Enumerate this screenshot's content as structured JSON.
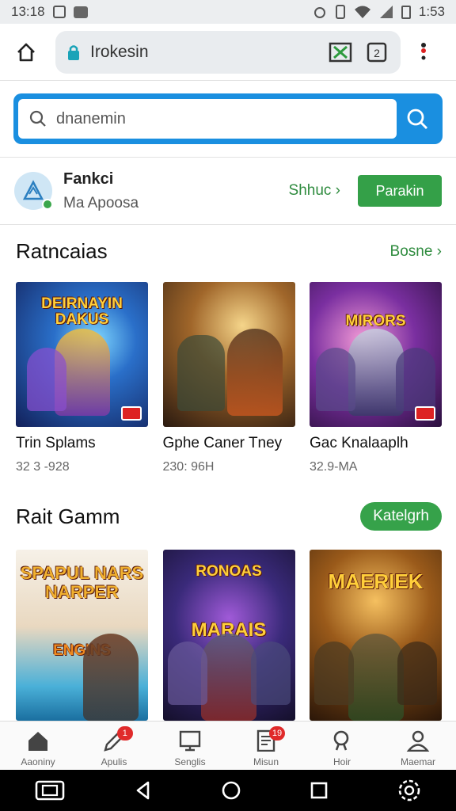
{
  "status_bar": {
    "time_left": "13:18",
    "time_right": "1:53"
  },
  "browser": {
    "url": "Irokesin"
  },
  "search": {
    "placeholder": "dnanemin"
  },
  "account": {
    "name": "Fankci",
    "subtitle": "Ma Apoosa",
    "link_label": "Shhuc ›",
    "button_label": "Parakin"
  },
  "section1": {
    "title": "Ratncaias",
    "link_label": "Bosne ›",
    "items": [
      {
        "title": "Trin Splams",
        "subtitle": "32 3 -928",
        "art_title": "DEIRNAYIN DAKUS"
      },
      {
        "title": "Gphe Caner Tney",
        "subtitle": "230: 96H",
        "art_title": ""
      },
      {
        "title": "Gac Knalaaplh",
        "subtitle": "32.9-MA",
        "art_title": "MIRORS"
      }
    ]
  },
  "section2": {
    "title": "Rait Gamm",
    "button_label": "Katelgrh",
    "items": [
      {
        "art_title": "SPAPUL NARS NARPER",
        "art_sub": "ENGINS"
      },
      {
        "art_title": "RONOAS",
        "art_sub": "MARAIS"
      },
      {
        "art_title": "MAERIEK",
        "art_sub": ""
      }
    ]
  },
  "bottom_nav": [
    {
      "label": "Aaoniny",
      "icon": "home-icon",
      "badge": ""
    },
    {
      "label": "Apulis",
      "icon": "pen-icon",
      "badge": "1"
    },
    {
      "label": "Senglis",
      "icon": "display-icon",
      "badge": ""
    },
    {
      "label": "Misun",
      "icon": "document-icon",
      "badge": "19"
    },
    {
      "label": "Hoir",
      "icon": "search-icon",
      "badge": ""
    },
    {
      "label": "Maemar",
      "icon": "profile-icon",
      "badge": ""
    }
  ],
  "colors": {
    "accent_blue": "#1a8fe0",
    "accent_green": "#34a048"
  }
}
